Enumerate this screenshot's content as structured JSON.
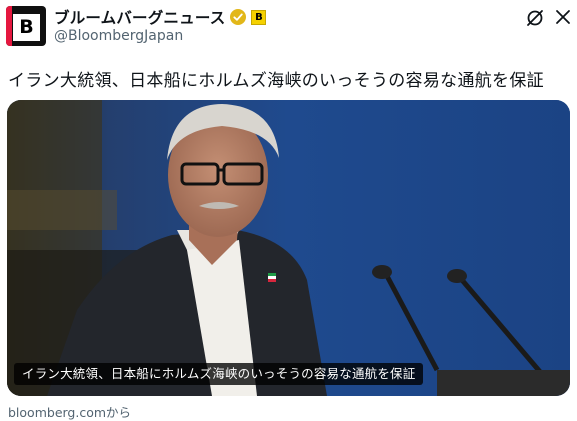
{
  "account": {
    "display_name": "ブルームバーグニュース",
    "handle": "@BloombergJapan",
    "avatar_letter": "B",
    "affiliate_badge_letter": "B",
    "verified_color": "#e2b719"
  },
  "tweet": {
    "headline": "イラン大統領、日本船にホルムズ海峡のいっそうの容易な通航を保証"
  },
  "media": {
    "caption": "イラン大統領、日本船にホルムズ海峡のいっそうの容易な通航を保証",
    "source": "bloomberg.comから"
  },
  "icons": {
    "mute": "mute-icon",
    "close": "close-icon",
    "verified": "verified-badge-icon"
  },
  "colors": {
    "text_primary": "#0f1419",
    "text_secondary": "#536471",
    "brand_red": "#e5173f",
    "photo_background": "#1e4a8c"
  }
}
